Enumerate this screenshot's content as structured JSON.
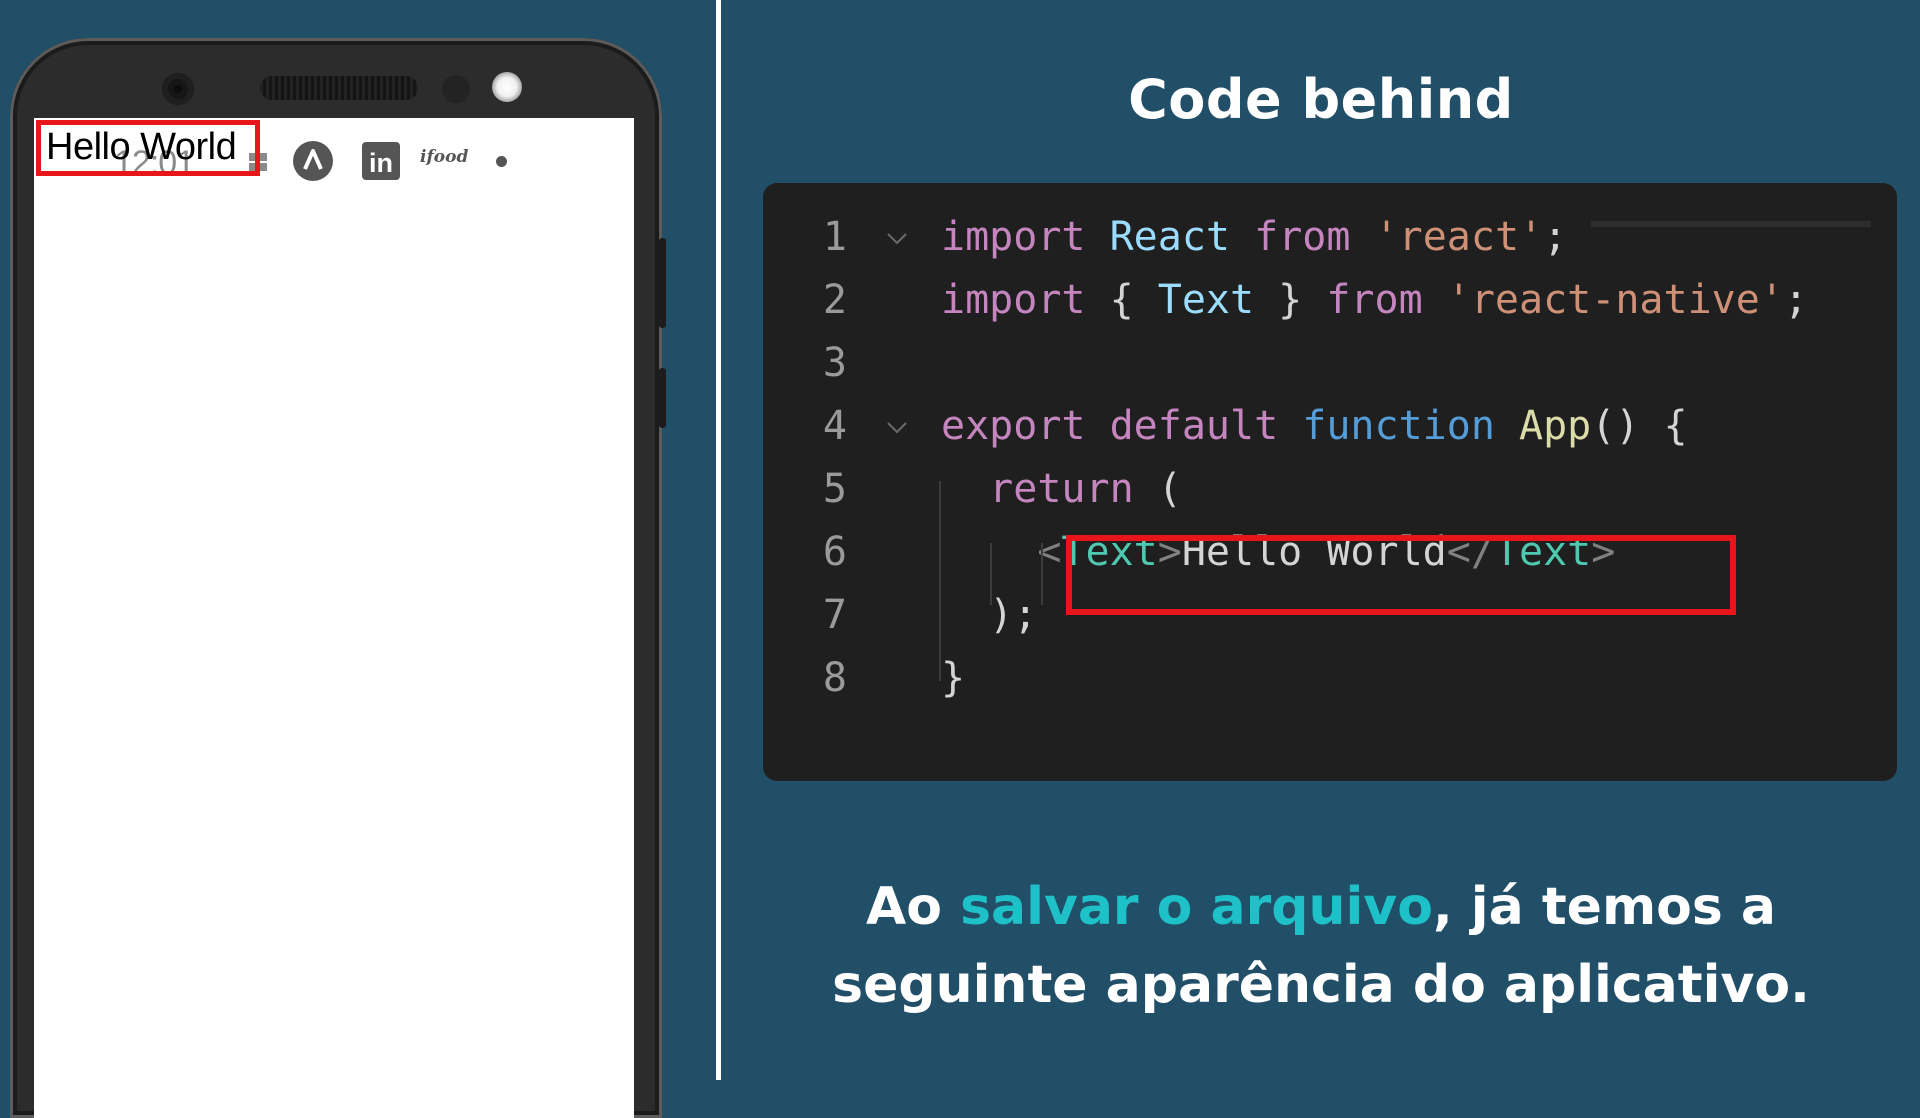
{
  "phone": {
    "status_time": "12:01",
    "status_icons": [
      "grid-icon",
      "angular-icon",
      "linkedin-icon",
      "ifood-icon",
      "dot-icon"
    ],
    "ifood_label": "ifood",
    "linkedin_label": "in",
    "app_text": "Hello World",
    "highlight_color": "#e8161b"
  },
  "title": "Code behind",
  "code": {
    "lines": [
      {
        "n": "1",
        "tokens": [
          {
            "t": "import",
            "c": "kw"
          },
          {
            "t": " ",
            "c": "plain"
          },
          {
            "t": "React",
            "c": "id"
          },
          {
            "t": " ",
            "c": "plain"
          },
          {
            "t": "from",
            "c": "kw"
          },
          {
            "t": " ",
            "c": "plain"
          },
          {
            "t": "'react'",
            "c": "str"
          },
          {
            "t": ";",
            "c": "plain"
          }
        ]
      },
      {
        "n": "2",
        "tokens": [
          {
            "t": "import",
            "c": "kw"
          },
          {
            "t": " { ",
            "c": "plain"
          },
          {
            "t": "Text",
            "c": "id"
          },
          {
            "t": " } ",
            "c": "plain"
          },
          {
            "t": "from",
            "c": "kw"
          },
          {
            "t": " ",
            "c": "plain"
          },
          {
            "t": "'react-native'",
            "c": "str"
          },
          {
            "t": ";",
            "c": "plain"
          }
        ]
      },
      {
        "n": "3",
        "tokens": []
      },
      {
        "n": "4",
        "tokens": [
          {
            "t": "export",
            "c": "kw"
          },
          {
            "t": " ",
            "c": "plain"
          },
          {
            "t": "default",
            "c": "kw"
          },
          {
            "t": " ",
            "c": "plain"
          },
          {
            "t": "function",
            "c": "decl"
          },
          {
            "t": " ",
            "c": "plain"
          },
          {
            "t": "App",
            "c": "fn"
          },
          {
            "t": "() {",
            "c": "plain"
          }
        ]
      },
      {
        "n": "5",
        "tokens": [
          {
            "t": "  ",
            "c": "plain"
          },
          {
            "t": "return",
            "c": "kw"
          },
          {
            "t": " (",
            "c": "plain"
          }
        ]
      },
      {
        "n": "6",
        "tokens": [
          {
            "t": "    ",
            "c": "plain"
          },
          {
            "t": "<",
            "c": "brk"
          },
          {
            "t": "Text",
            "c": "tag"
          },
          {
            "t": ">",
            "c": "brk"
          },
          {
            "t": "Hello World",
            "c": "plain"
          },
          {
            "t": "</",
            "c": "brk"
          },
          {
            "t": "Text",
            "c": "tag"
          },
          {
            "t": ">",
            "c": "brk"
          }
        ]
      },
      {
        "n": "7",
        "tokens": [
          {
            "t": "  );",
            "c": "plain"
          }
        ]
      },
      {
        "n": "8",
        "tokens": [
          {
            "t": "}",
            "c": "plain"
          }
        ]
      }
    ],
    "colors": {
      "background": "#1f1f1f",
      "keyword": "#c586c0",
      "identifier": "#9cdcfe",
      "string": "#ce9178",
      "function": "#dcdcaa",
      "declaration": "#569cd6",
      "tag": "#4ec9b0"
    }
  },
  "caption": {
    "part1": "Ao ",
    "accent": "salvar o arquivo",
    "part2": ", já temos a",
    "line2": "seguinte aparência do aplicativo.",
    "accent_color": "#1fc1c9"
  },
  "colors": {
    "background": "#214f67",
    "highlight": "#e8161b"
  }
}
